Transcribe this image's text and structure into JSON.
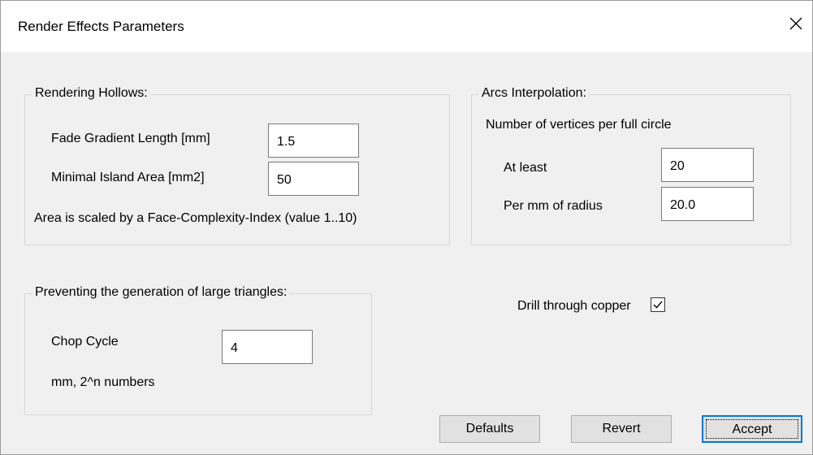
{
  "window": {
    "title": "Render Effects Parameters",
    "close_icon": "close-icon"
  },
  "hollows": {
    "legend": "Rendering Hollows:",
    "fade_label": "Fade Gradient Length [mm]",
    "fade_value": "1.5",
    "island_label": "Minimal Island Area [mm2]",
    "island_value": "50",
    "note": "Area is scaled by a Face-Complexity-Index (value 1..10)"
  },
  "arcs": {
    "legend": "Arcs Interpolation:",
    "subtitle": "Number of vertices per full circle",
    "atleast_label": "At least",
    "atleast_value": "20",
    "permm_label": "Per mm of radius",
    "permm_value": "20.0"
  },
  "triangles": {
    "legend": "Preventing the generation of large triangles:",
    "chop_label": "Chop Cycle",
    "chop_value": "4",
    "note": "mm, 2^n numbers"
  },
  "drill": {
    "label": "Drill through copper",
    "checked": true
  },
  "buttons": {
    "defaults": "Defaults",
    "revert": "Revert",
    "accept": "Accept"
  },
  "colors": {
    "accent": "#0078d7",
    "background": "#f0f0f0"
  }
}
